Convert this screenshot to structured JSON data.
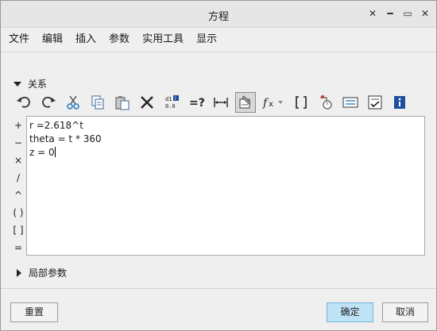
{
  "window": {
    "title": "方程"
  },
  "title_controls": {
    "menu_glyph": "✕",
    "minimize_glyph": "━",
    "restore_glyph": "▭",
    "close_glyph": "✕"
  },
  "menu": [
    "文件",
    "编辑",
    "插入",
    "参数",
    "实用工具",
    "显示"
  ],
  "relations_section": {
    "label": "关系"
  },
  "operators": [
    "+",
    "−",
    "×",
    "/",
    "^",
    "( )",
    "[ ]",
    "="
  ],
  "editor": {
    "lines": [
      "r =2.618^t",
      "theta = t * 360",
      "z = 0"
    ]
  },
  "local_params_section": {
    "label": "局部参数"
  },
  "buttons": {
    "reset": "重置",
    "ok": "确定",
    "cancel": "取消"
  },
  "colors": {
    "primary_button": "#bfe3f6",
    "info_icon": "#1d4f9e",
    "cut_icon": "#2f7fc0"
  }
}
